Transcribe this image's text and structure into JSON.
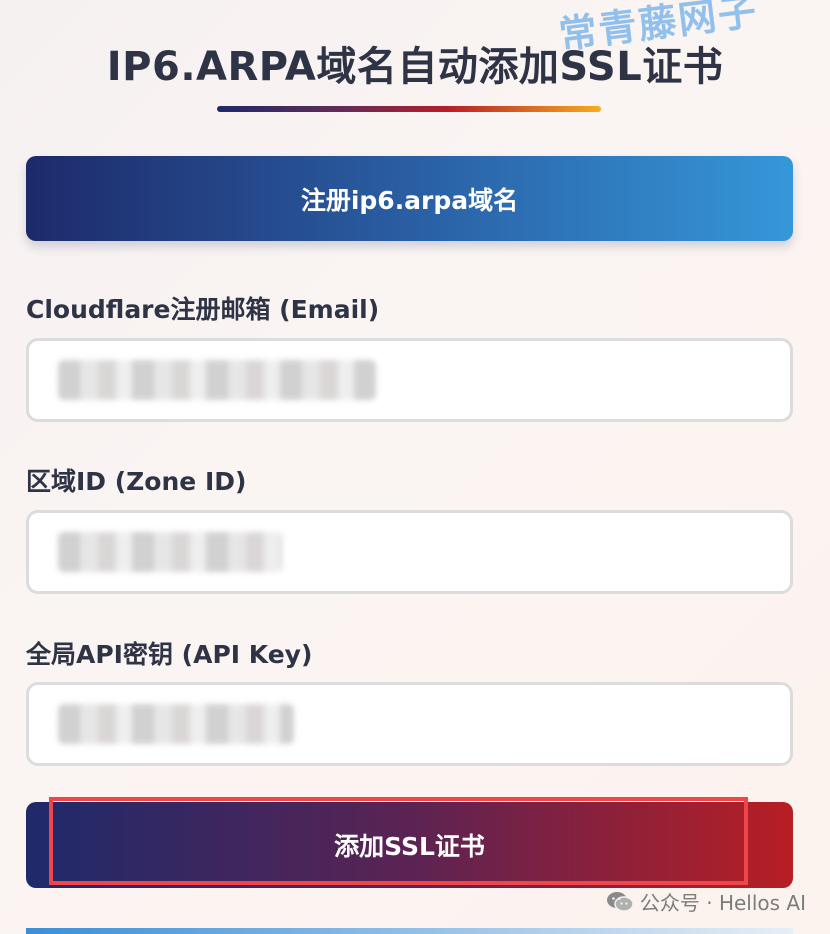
{
  "watermark": "常青藤网子",
  "page_title": "IP6.ARPA域名自动添加SSL证书",
  "register_button": "注册ip6.arpa域名",
  "form": {
    "email_label": "Cloudflare注册邮箱 (Email)",
    "zone_label": "区域ID (Zone ID)",
    "api_key_label": "全局API密钥 (API Key)"
  },
  "submit_button": "添加SSL证书",
  "footer": {
    "account": "公众号 · Hellos AI",
    "icon": "wechat-icon"
  },
  "colors": {
    "highlight": "#f0464a",
    "title_text": "#2e3446"
  }
}
